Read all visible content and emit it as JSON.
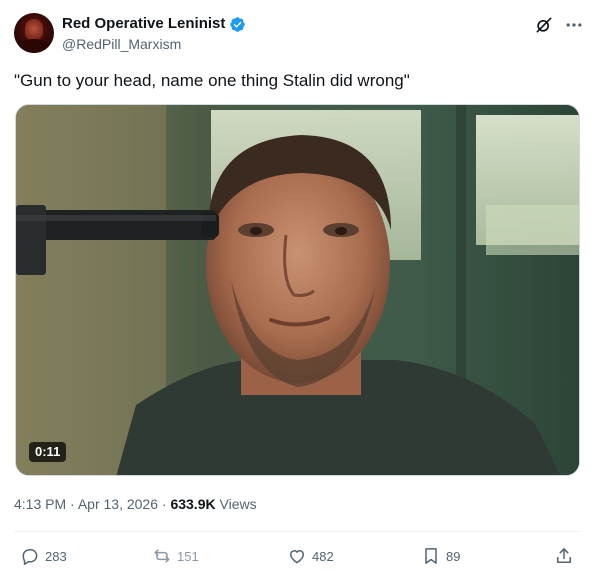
{
  "author": {
    "display_name": "Red Operative Leninist",
    "handle": "@RedPill_Marxism",
    "verified": true,
    "verified_color": "#1d9bf0"
  },
  "header_icons": [
    "grok-icon",
    "more-icon"
  ],
  "tweet": {
    "text": "\"Gun to your head, name one thing Stalin did wrong\""
  },
  "media": {
    "type": "video",
    "duration": "0:11"
  },
  "meta": {
    "time": "4:13 PM",
    "separator": "·",
    "date": "Apr 13, 2026",
    "views_count": "633.9K",
    "views_label": "Views"
  },
  "actions": {
    "replies": "283",
    "reposts": "151",
    "likes": "482",
    "bookmarks": "89"
  },
  "colors": {
    "text": "#0f1419",
    "secondary": "#536471",
    "repost_faded": "#8b98a5"
  }
}
